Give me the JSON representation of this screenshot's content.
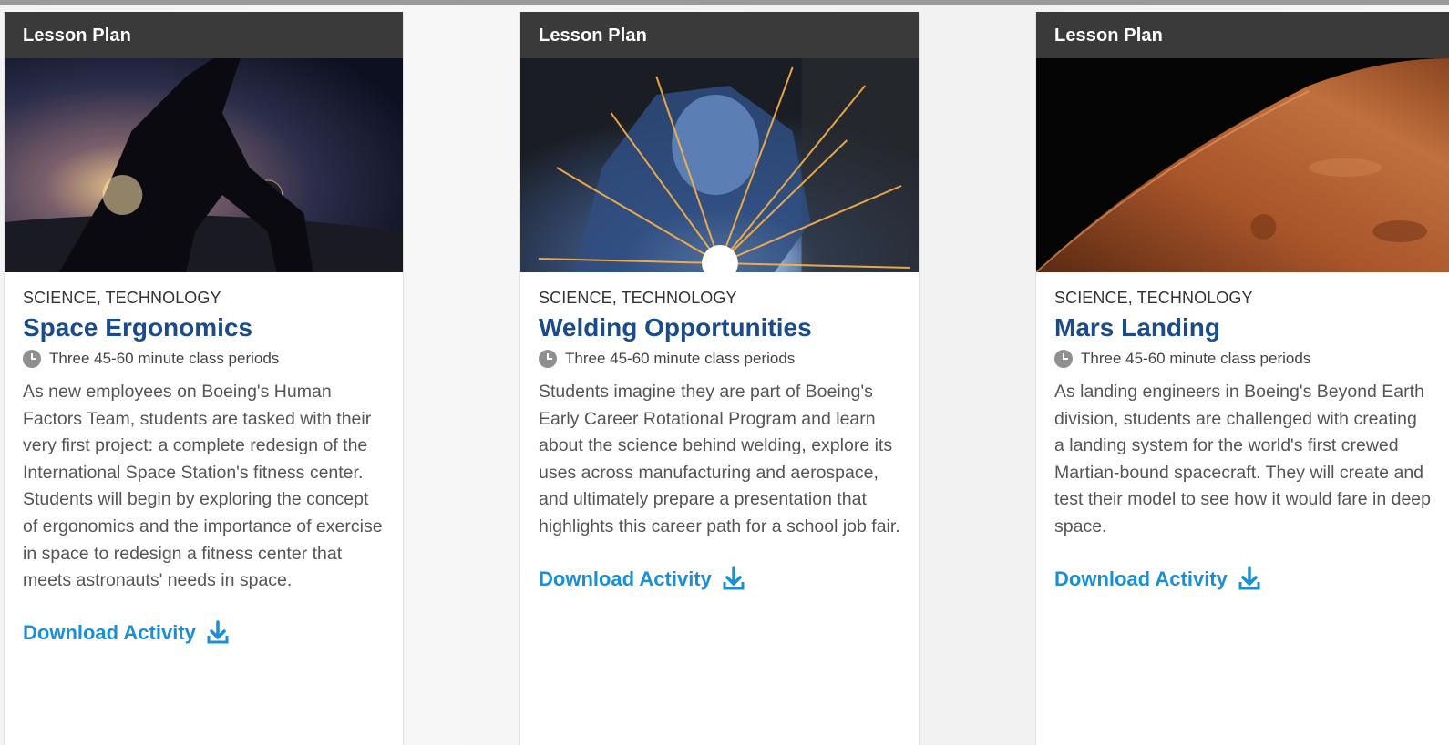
{
  "cards": [
    {
      "header": "Lesson Plan",
      "subjects": "SCIENCE, TECHNOLOGY",
      "title": "Space Ergonomics",
      "duration": "Three 45-60 minute class periods",
      "description": "As new employees on Boeing's Human Factors Team, students are tasked with their very first project: a complete redesign of the International Space Station's fitness center. Students will begin by exploring the concept of ergonomics and the importance of exercise in space to redesign a fitness center that meets astronauts' needs in space.",
      "download_label": "Download Activity",
      "icon": "download-icon"
    },
    {
      "header": "Lesson Plan",
      "subjects": "SCIENCE, TECHNOLOGY",
      "title": "Welding Opportunities",
      "duration": "Three 45-60 minute class periods",
      "description": "Students imagine they are part of Boeing's Early Career Rotational Program and learn about the science behind welding, explore its uses across manufacturing and aerospace, and ultimately prepare a presentation that highlights this career path for a school job fair.",
      "download_label": "Download Activity",
      "icon": "download-icon"
    },
    {
      "header": "Lesson Plan",
      "subjects": "SCIENCE, TECHNOLOGY",
      "title": "Mars Landing",
      "duration": "Three 45-60 minute class periods",
      "description": "As landing engineers in Boeing's Beyond Earth division, students are challenged with creating a landing system for the world's first crewed Martian-bound spacecraft. They will create and test their model to see how it would fare in deep space.",
      "download_label": "Download Activity",
      "icon": "download-icon"
    }
  ],
  "colors": {
    "header_bg": "#3a3a3a",
    "title": "#1a4b8c",
    "link": "#1a8fd6"
  }
}
